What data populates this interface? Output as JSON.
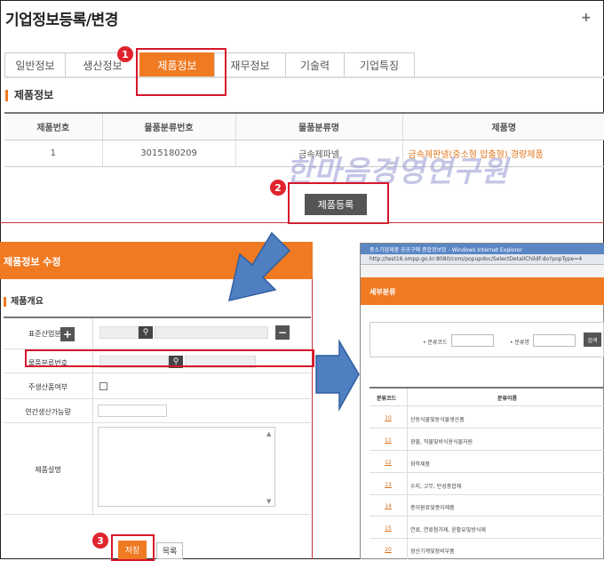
{
  "page": {
    "title": "기업정보등록/변경",
    "expand_symbol": "+"
  },
  "tabs": [
    {
      "label": "일반정보",
      "active": false
    },
    {
      "label": "생산정보",
      "active": false
    },
    {
      "label": "제품정보",
      "active": true
    },
    {
      "label": "재무정보",
      "active": false
    },
    {
      "label": "기술력",
      "active": false
    },
    {
      "label": "기업특징",
      "active": false
    }
  ],
  "product_section": {
    "title": "제품정보",
    "columns": [
      "제품번호",
      "물품분류번호",
      "물품분류명",
      "제품명"
    ],
    "rows": [
      {
        "no": "1",
        "class_no": "3015180209",
        "class_name": "금속제파넬",
        "product_name": "금속제판넬(중소형 압출형) 경량제품"
      }
    ],
    "register_button": "제품등록"
  },
  "watermark": "한마음경영연구원",
  "steps": [
    "1",
    "2",
    "3"
  ],
  "form": {
    "header": "제품정보 수정",
    "subtitle": "제품개요",
    "fields": {
      "industry_class": "표준산업분류",
      "goods_class_no": "물품분류번호",
      "main_product": "주생산품여부",
      "annual_capacity": "연간생산가능량",
      "description": "제품설명"
    },
    "save_button": "저장",
    "list_button": "목록"
  },
  "popup": {
    "window_title": "중소기업제품 공공구매 종합정보망 - Windows Internet Explorer",
    "address": "http://test16.smpp.go.kr:8080/com/popupdoc/SelectDetailChildF.do?popType=4",
    "header": "세부분류",
    "search_code_label": "분류코드",
    "search_name_label": "분류명",
    "search_button": "검색",
    "columns": [
      "분류코드",
      "분류이름"
    ],
    "rows": [
      {
        "code": "10",
        "name": "산동식물및동식물생산품"
      },
      {
        "code": "11",
        "name": "광물, 직물및비식용식물자원"
      },
      {
        "code": "12",
        "name": "화학제품"
      },
      {
        "code": "13",
        "name": "수지, 고무, 탄성중합체"
      },
      {
        "code": "14",
        "name": "종이원료및종이제품"
      },
      {
        "code": "15",
        "name": "연료, 연료첨가제, 윤활유및방식제"
      },
      {
        "code": "20",
        "name": "광산기계및장비부품"
      }
    ]
  },
  "colors": {
    "accent": "#f07a22",
    "highlight_red": "#d8162a",
    "arrow_blue": "#4f7fc0"
  },
  "icons": [
    "magnifier-icon",
    "plus-icon",
    "minus-icon",
    "scroll-up-icon",
    "scroll-down-icon"
  ]
}
